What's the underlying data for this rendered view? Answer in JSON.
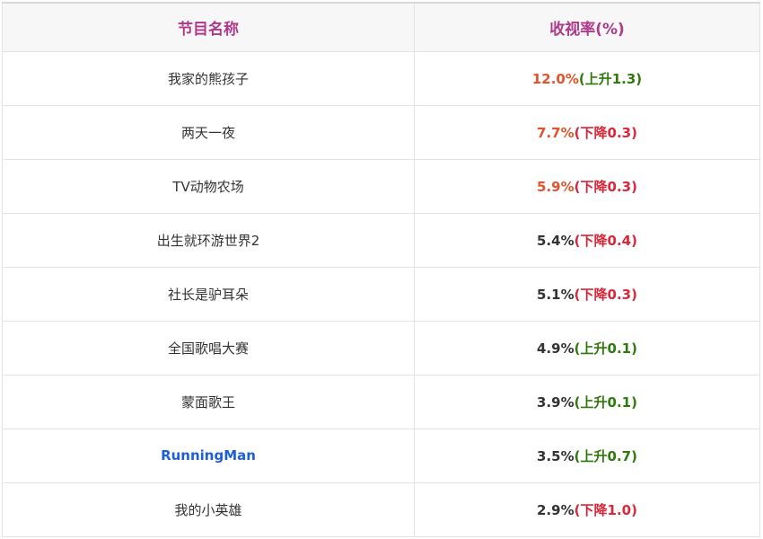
{
  "table": {
    "headers": {
      "name": "节目名称",
      "rating": "收视率(%)"
    },
    "colors": {
      "header_text": "#b03a8a",
      "hot_value": "#e0532b",
      "up": "#2f7a0c",
      "down": "#d8283a",
      "link_name": "#1f5fd6"
    },
    "rows": [
      {
        "name": "我家的熊孩子",
        "rating": "12.0%",
        "change": "(上升1.3)",
        "trend": "up",
        "hot": true,
        "name_highlight": false
      },
      {
        "name": "两天一夜",
        "rating": "7.7%",
        "change": "(下降0.3)",
        "trend": "down",
        "hot": true,
        "name_highlight": false
      },
      {
        "name": "TV动物农场",
        "rating": "5.9%",
        "change": "(下降0.3)",
        "trend": "down",
        "hot": true,
        "name_highlight": false
      },
      {
        "name": "出生就环游世界2",
        "rating": "5.4%",
        "change": "(下降0.4)",
        "trend": "down",
        "hot": false,
        "name_highlight": false
      },
      {
        "name": "社长是驴耳朵",
        "rating": "5.1%",
        "change": "(下降0.3)",
        "trend": "down",
        "hot": false,
        "name_highlight": false
      },
      {
        "name": "全国歌唱大赛",
        "rating": "4.9%",
        "change": "(上升0.1)",
        "trend": "up",
        "hot": false,
        "name_highlight": false
      },
      {
        "name": "蒙面歌王",
        "rating": "3.9%",
        "change": "(上升0.1)",
        "trend": "up",
        "hot": false,
        "name_highlight": false
      },
      {
        "name": "RunningMan",
        "rating": "3.5%",
        "change": "(上升0.7)",
        "trend": "up",
        "hot": false,
        "name_highlight": true
      },
      {
        "name": "我的小英雄",
        "rating": "2.9%",
        "change": "(下降1.0)",
        "trend": "down",
        "hot": false,
        "name_highlight": false
      }
    ]
  }
}
